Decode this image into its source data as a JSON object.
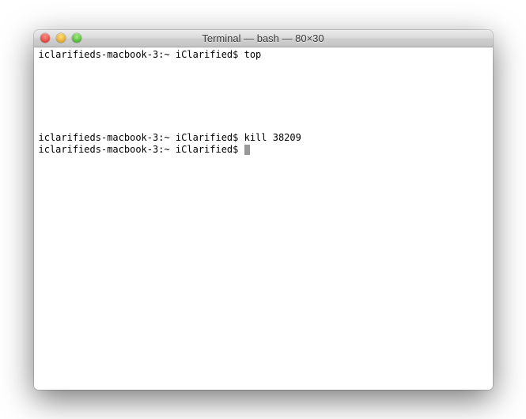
{
  "window": {
    "title": "Terminal — bash — 80×30"
  },
  "terminal": {
    "lines": [
      {
        "prompt": "iclarifieds-macbook-3:~ iClarified$ ",
        "command": "top"
      },
      {
        "prompt": "",
        "command": ""
      },
      {
        "prompt": "",
        "command": ""
      },
      {
        "prompt": "",
        "command": ""
      },
      {
        "prompt": "",
        "command": ""
      },
      {
        "prompt": "",
        "command": ""
      },
      {
        "prompt": "",
        "command": ""
      },
      {
        "prompt": "iclarifieds-macbook-3:~ iClarified$ ",
        "command": "kill 38209"
      },
      {
        "prompt": "iclarifieds-macbook-3:~ iClarified$ ",
        "command": "",
        "cursor": true
      }
    ]
  }
}
